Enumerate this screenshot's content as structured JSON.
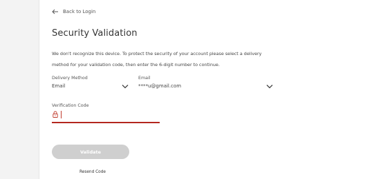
{
  "back_link": {
    "label": "Back to Login"
  },
  "title": "Security Validation",
  "description": "We don't recognize this device. To protect the security of your account please select a delivery method for your validation code, then enter the 6-digit number to continue.",
  "delivery_method": {
    "label": "Delivery Method",
    "value": "Email"
  },
  "email": {
    "label": "Email",
    "value": "****u@gmail.com"
  },
  "verification": {
    "label": "Verification Code",
    "value": ""
  },
  "validate_button": {
    "label": "Validate"
  },
  "resend_link": {
    "label": "Resend Code"
  },
  "colors": {
    "error_underline": "#b3261e",
    "button_disabled": "#cfcfcf",
    "lock_icon": "#c0392b"
  }
}
